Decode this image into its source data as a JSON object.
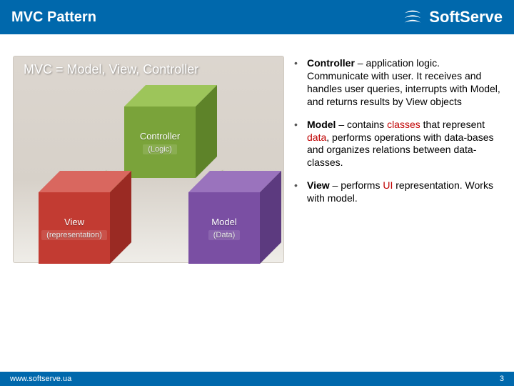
{
  "header": {
    "title": "MVC Pattern",
    "brand": "SoftServe"
  },
  "diagram": {
    "title": "MVC = Model, View, Controller",
    "boxes": {
      "controller": {
        "name": "Controller",
        "sub": "(Logic)"
      },
      "view": {
        "name": "View",
        "sub": "(representation)"
      },
      "model": {
        "name": "Model",
        "sub": "(Data)"
      }
    }
  },
  "bullets": [
    {
      "term": "Controller",
      "pre": " – application logic. Communicate with user. It receives and handles user queries, interrupts with Model, and returns results by View objects"
    },
    {
      "term": "Model",
      "pre": " –   contains ",
      "hl1": "classes",
      "mid": " that represent ",
      "hl2": "data",
      "post": ", performs operations with data-bases and organizes relations between data-classes."
    },
    {
      "term": "View",
      "pre": " – performs ",
      "hl1": "UI",
      "post": " representation. Works with model."
    }
  ],
  "footer": {
    "url": "www.softserve.ua",
    "page": "3"
  }
}
